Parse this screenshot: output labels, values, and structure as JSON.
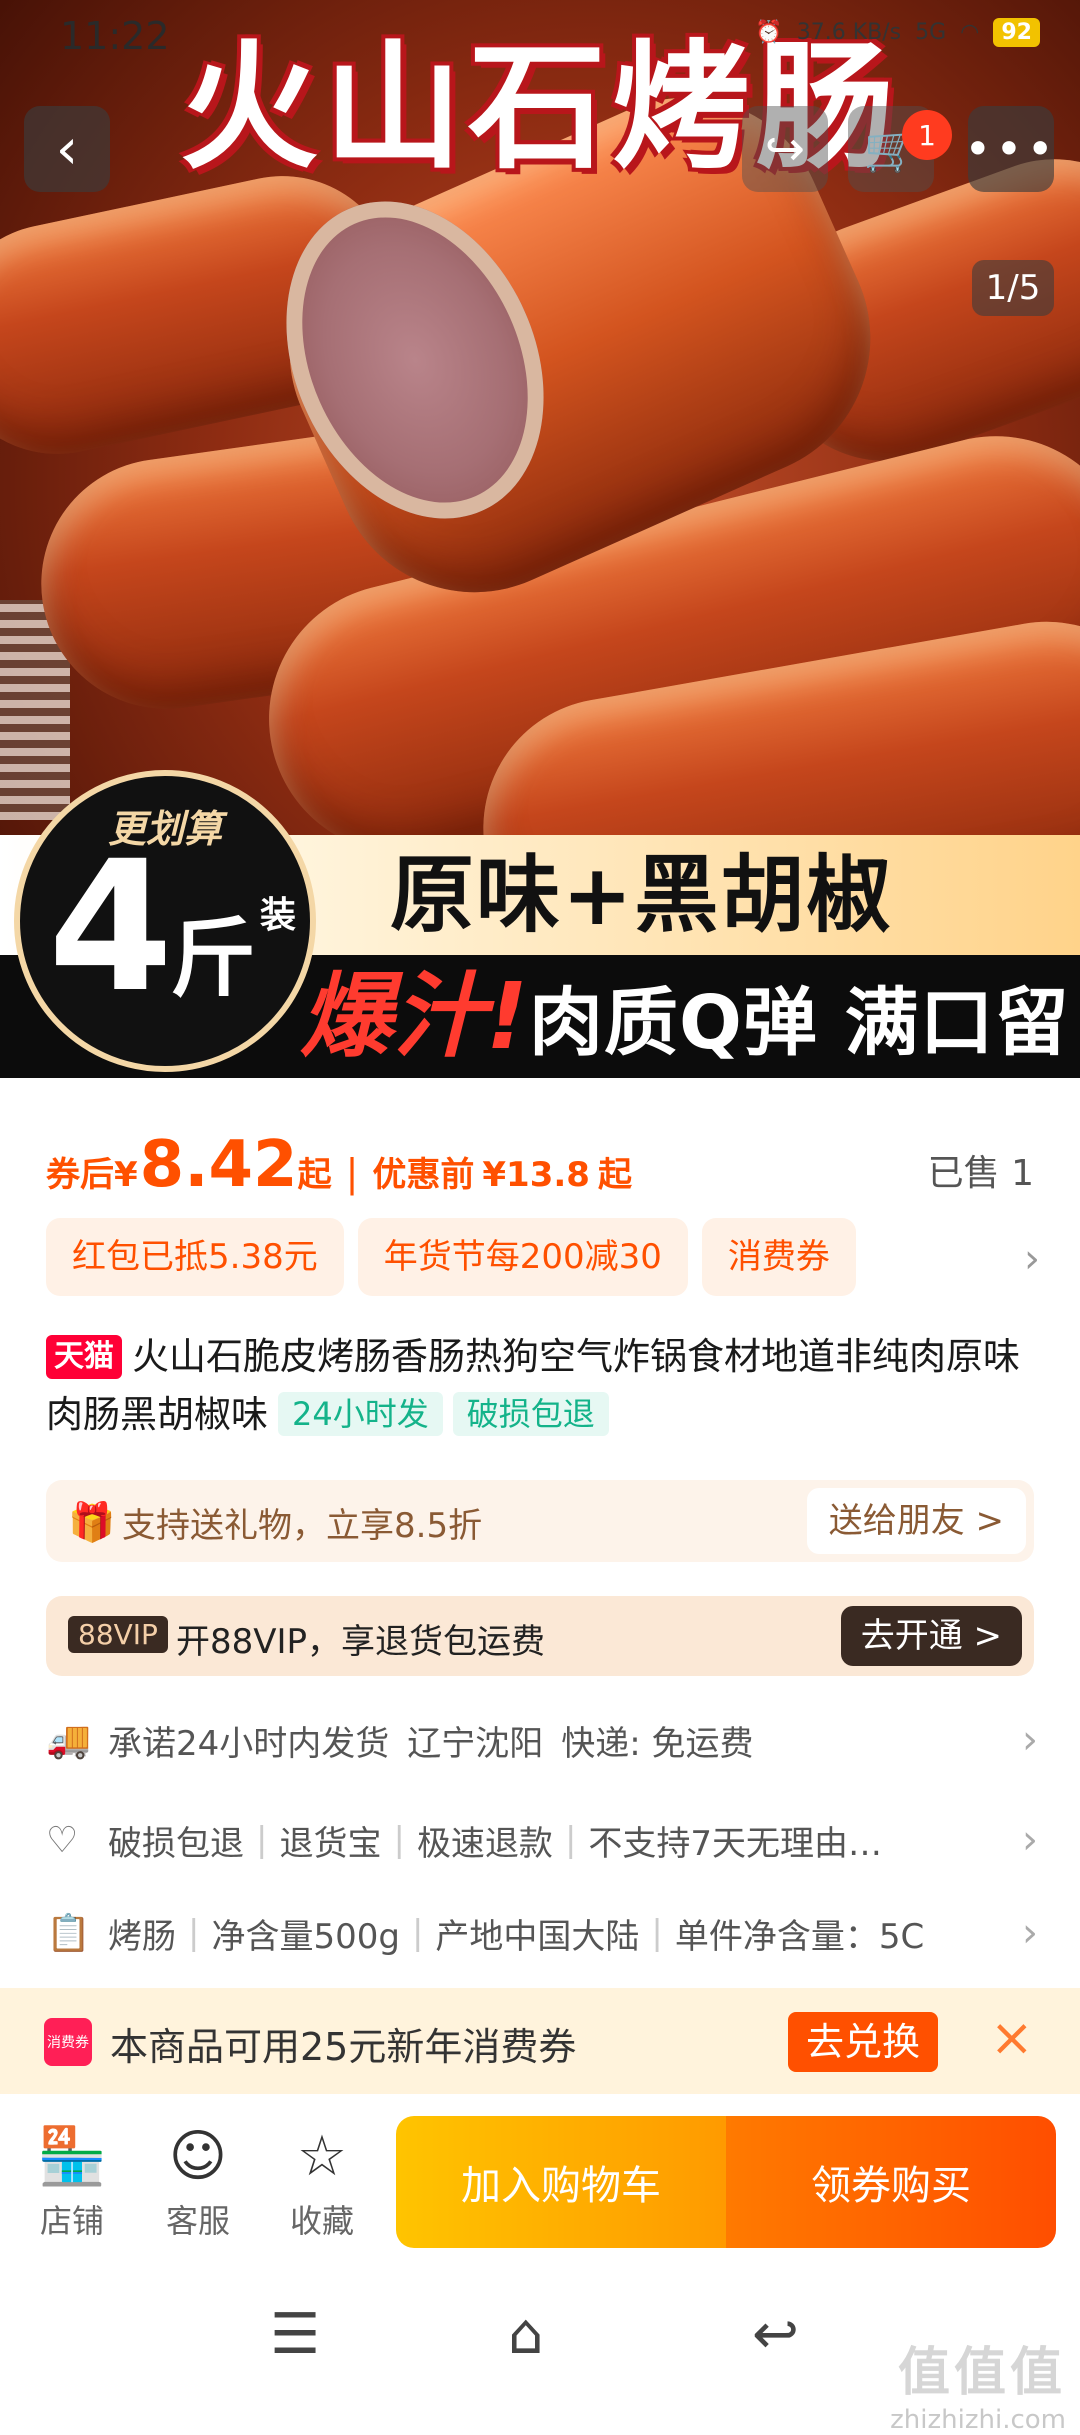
{
  "status_bar": {
    "time": "11:22",
    "net_speed": "37.6",
    "net_unit": "KB/s",
    "network": "5G",
    "battery": "92"
  },
  "hero": {
    "title": "火山石烤肠",
    "circle_top": "更划算",
    "circle_number": "4",
    "circle_unit": "斤",
    "circle_pack": "装",
    "band_line1": "原味+黑胡椒",
    "band_red": "爆汁!",
    "band_line2": "肉质Q弹 满口留香",
    "image_counter": "1/5",
    "cart_badge": "1"
  },
  "icons": {
    "back": "chevron-left-icon",
    "share": "share-icon",
    "cart": "cart-icon",
    "more": "more-icon"
  },
  "price": {
    "after_label": "券后",
    "currency": "¥",
    "after_value": "8.42",
    "after_suffix": "起",
    "separator": "|",
    "before_label": "优惠前",
    "before_value": "¥13.8",
    "before_suffix": "起",
    "sold": "已售 1"
  },
  "chips": [
    "红包已抵5.38元",
    "年货节每200减30",
    "消费券"
  ],
  "product": {
    "store_badge": "天猫",
    "title": "火山石脆皮烤肠香肠热狗空气炸锅食材地道非纯肉原味肉肠黑胡椒味",
    "tag1": "24小时发",
    "tag2": "破损包退"
  },
  "gift": {
    "text": "支持送礼物，立享8.5折",
    "button": "送给朋友 >"
  },
  "vip": {
    "badge": "88VIP",
    "text": "开88VIP，享退货包运费",
    "button": "去开通 >"
  },
  "shipping": {
    "promise": "承诺24小时内发货",
    "location": "辽宁沈阳",
    "express": "快递: 免运费"
  },
  "guarantee": {
    "items": [
      "破损包退",
      "退货宝",
      "极速退款",
      "不支持7天无理由…"
    ]
  },
  "specs": {
    "items": [
      "烤肠",
      "净含量500g",
      "产地中国大陆",
      "单件净含量：5C"
    ]
  },
  "coupon_bar": {
    "logo_text": "消费券",
    "text": "本商品可用25元新年消费券",
    "button": "去兑换",
    "close": "×"
  },
  "bottom_bar": {
    "shop": "店铺",
    "service": "客服",
    "favorite": "收藏",
    "add_to_cart": "加入购物车",
    "buy": "领券购买"
  },
  "watermark": {
    "brand": "值值值",
    "url": "zhizhizhi.com"
  },
  "colors": {
    "accent": "#ff5000",
    "tmall": "#ff0036",
    "green_tag": "#14b38a"
  }
}
